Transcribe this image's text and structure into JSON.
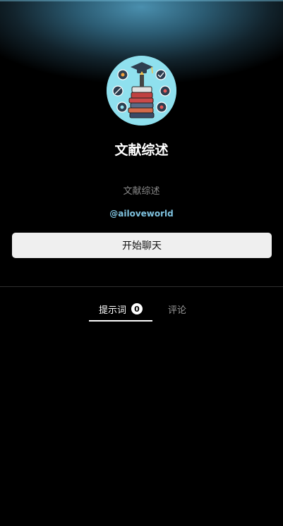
{
  "profile": {
    "title": "文献综述",
    "description": "文献综述",
    "author_handle": "@ailoveworld",
    "avatar_icon": "books-graduation-cap-icon"
  },
  "actions": {
    "start_chat_label": "开始聊天"
  },
  "tabs": [
    {
      "label": "提示词",
      "count": "0",
      "active": true
    },
    {
      "label": "评论",
      "active": false
    }
  ],
  "colors": {
    "background": "#000000",
    "accent_handle": "#7fc3e0",
    "button_bg": "#efefef",
    "avatar_bg": "#8fe0ee"
  }
}
